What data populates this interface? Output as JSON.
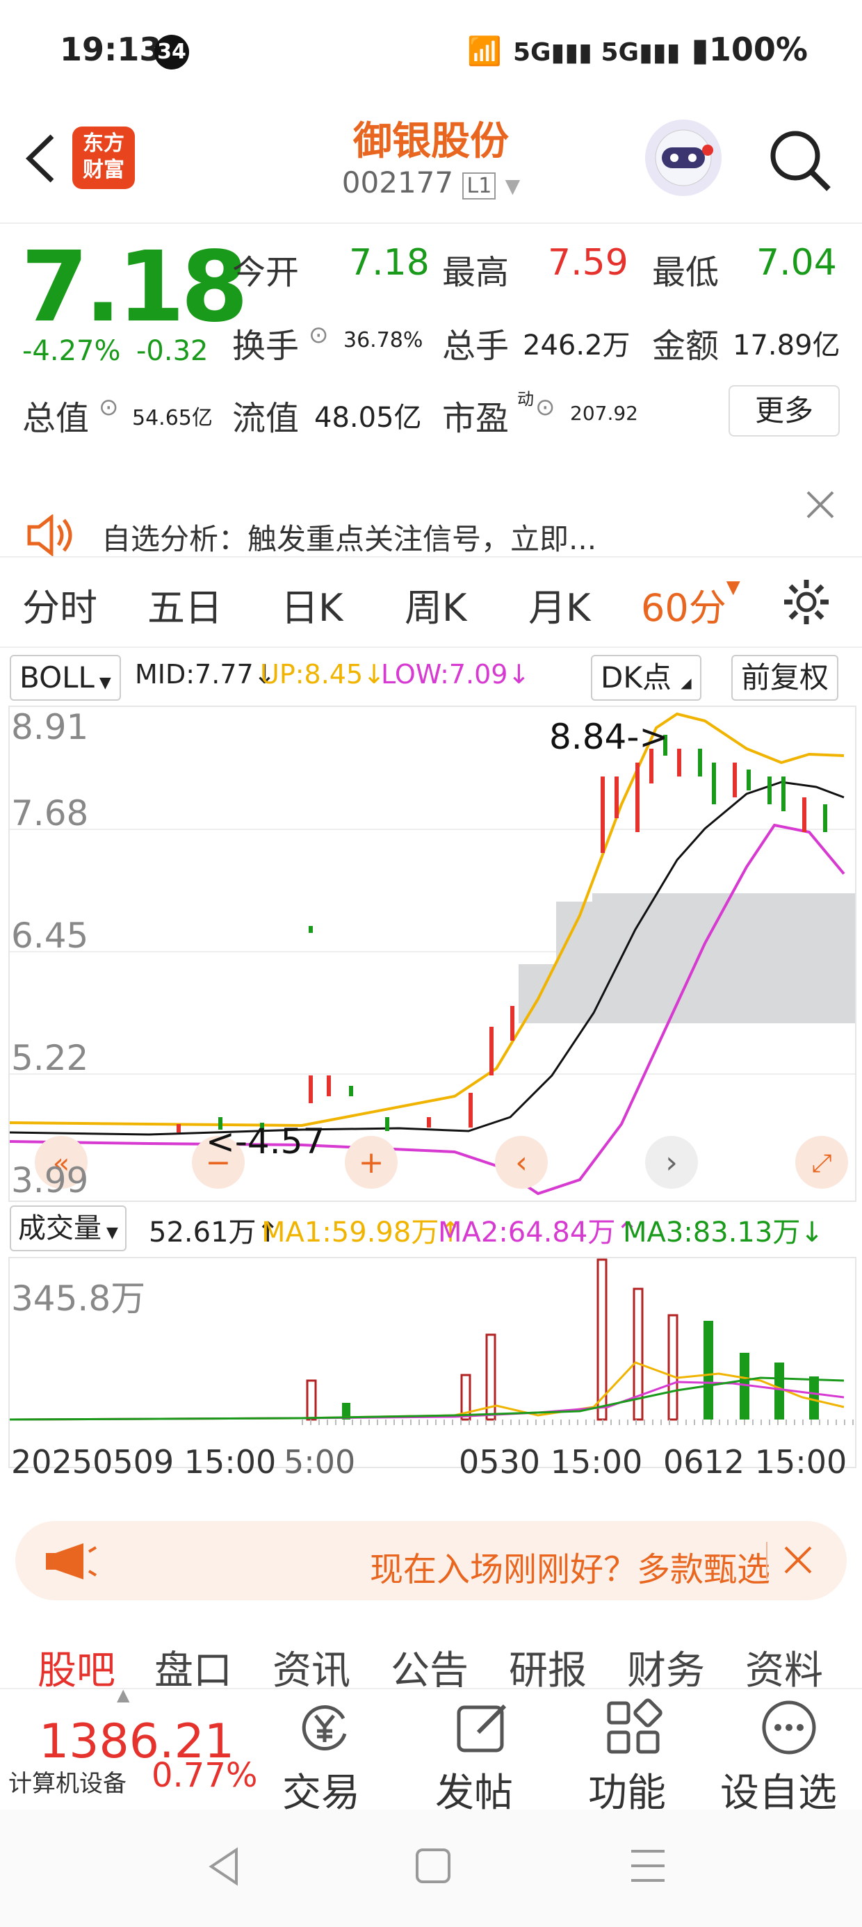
{
  "status": {
    "time": "19:13",
    "badge": "34",
    "battery": "100%"
  },
  "header": {
    "logo_line1": "东方",
    "logo_line2": "财富",
    "name": "御银股份",
    "code": "002177",
    "level": "L1"
  },
  "quote": {
    "price": "7.18",
    "change_pct": "-4.27%",
    "change": "-0.32",
    "open_label": "今开",
    "open": "7.18",
    "high_label": "最高",
    "high": "7.59",
    "low_label": "最低",
    "low": "7.04",
    "turnover_label": "换手",
    "turnover": "36.78%",
    "volume_label": "总手",
    "volume": "246.2万",
    "amount_label": "金额",
    "amount": "17.89亿",
    "mktcap_label": "总值",
    "mktcap": "54.65亿",
    "float_label": "流值",
    "float": "48.05亿",
    "pe_label": "市盈",
    "pe_sup": "动",
    "pe": "207.92",
    "more": "更多"
  },
  "promo": {
    "text": "自选分析：触发重点关注信号，立即..."
  },
  "tabs": {
    "t1": "分时",
    "t2": "五日",
    "t3": "日K",
    "t4": "周K",
    "t5": "月K",
    "t6": "60分"
  },
  "indicator": {
    "name": "BOLL",
    "mid": "MID:7.77↓",
    "up": "UP:8.45↓",
    "low": "LOW:7.09↓",
    "dk": "DK点",
    "fq": "前复权"
  },
  "kchart": {
    "y1": "8.91",
    "y2": "7.68",
    "y3": "6.45",
    "y4": "5.22",
    "y5": "3.99",
    "high_note": "8.84->",
    "low_note": "<-4.57"
  },
  "volume": {
    "name": "成交量",
    "value": "52.61万↑",
    "ma1": "MA1:59.98万↑",
    "ma2": "MA2:64.84万↑",
    "ma3": "MA3:83.13万↓",
    "ymax": "345.8万"
  },
  "axis": {
    "a1": "20250509 15:00",
    "a2": "5:00",
    "a3": "0530 15:00",
    "a4": "0612 15:00"
  },
  "ad": {
    "text": "现在入场刚刚好？多款甄选"
  },
  "bottom_tabs": {
    "b1": "股吧",
    "b2": "盘口",
    "b3": "资讯",
    "b4": "公告",
    "b5": "研报",
    "b6": "财务",
    "b7": "资料"
  },
  "nav": {
    "index_val": "1386.21",
    "index_name": "计算机设备",
    "index_pct": "0.77%",
    "trade": "交易",
    "post": "发帖",
    "func": "功能",
    "watch": "设自选"
  },
  "colors": {
    "up": "#e5322d",
    "down": "#1a9a1a",
    "accent": "#e8661f",
    "boll_up": "#f0b400",
    "boll_low": "#d63ad0"
  }
}
